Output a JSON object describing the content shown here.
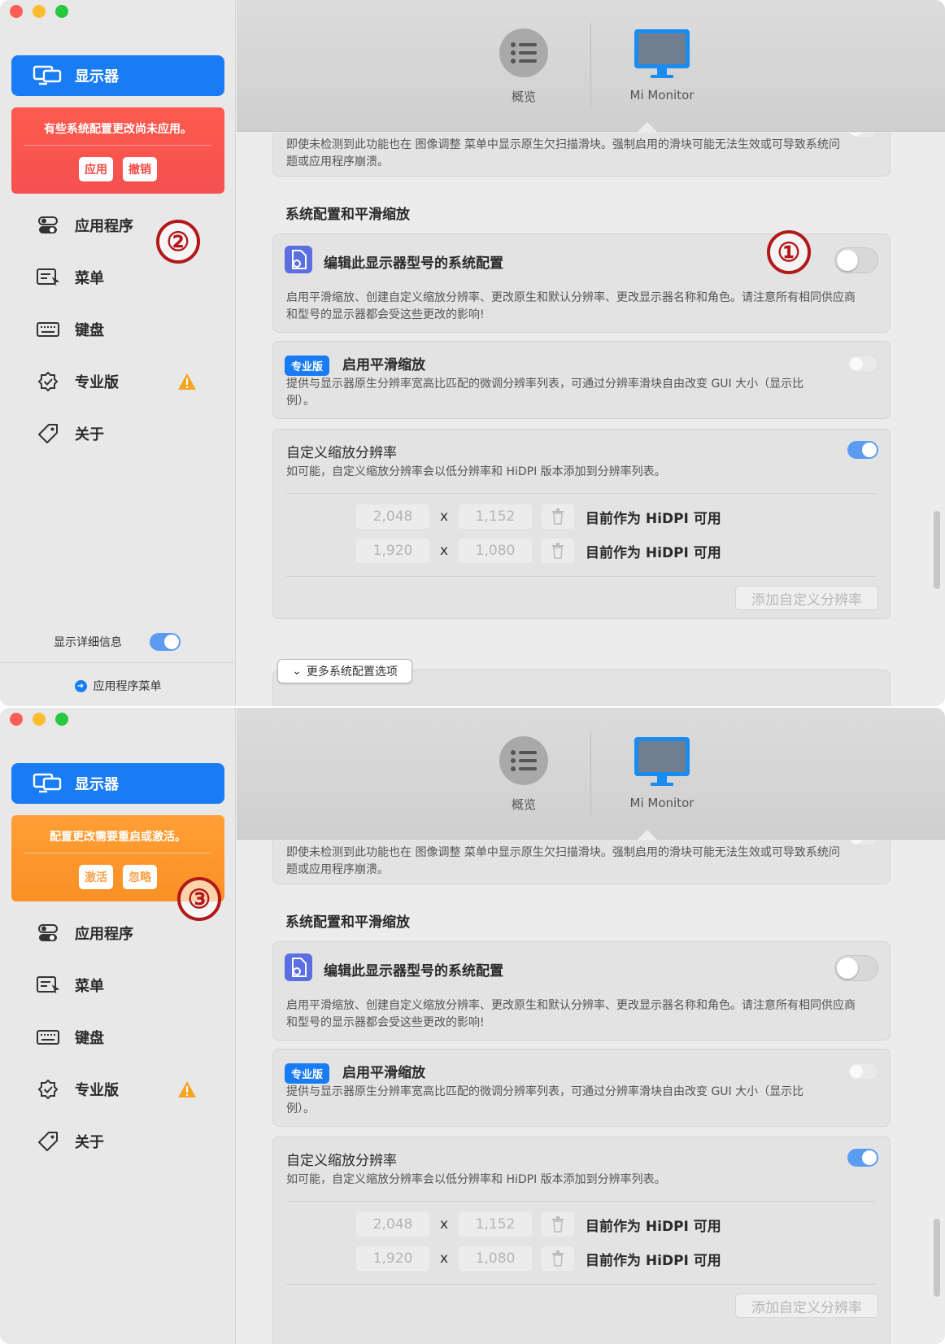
{
  "sidebar": {
    "selected": "显示器",
    "items": [
      {
        "label": "应用程序",
        "icon": "toggles-icon"
      },
      {
        "label": "菜单",
        "icon": "menu-icon"
      },
      {
        "label": "键盘",
        "icon": "keyboard-icon"
      },
      {
        "label": "专业版",
        "icon": "badge-check-icon",
        "warning": true
      },
      {
        "label": "关于",
        "icon": "tag-icon"
      }
    ],
    "show_details_label": "显示详细信息",
    "app_menu_label": "应用程序菜单"
  },
  "banners": [
    {
      "message": "有些系统配置更改尚未应用。",
      "primary": "应用",
      "secondary": "撤销",
      "color": "#f45050"
    },
    {
      "message": "配置更改需要重启或激活。",
      "primary": "激活",
      "secondary": "忽略",
      "color": "#fa9026"
    }
  ],
  "toolbar": {
    "overview_label": "概览",
    "monitor_label": "Mi Monitor"
  },
  "main": {
    "top_card_desc": "即使未检测到此功能也在 图像调整 菜单中显示原生欠扫描滑块。强制启用的滑块可能无法生效或可导致系统问题或应用程序崩溃。",
    "section_title": "系统配置和平滑缩放",
    "edit_config": {
      "title": "编辑此显示器型号的系统配置",
      "desc": "启用平滑缩放、创建自定义缩放分辨率、更改原生和默认分辨率、更改显示器名称和角色。请注意所有相同供应商和型号的显示器都会受这些更改的影响!",
      "enabled": false
    },
    "smooth_scaling": {
      "badge": "专业版",
      "title": "启用平滑缩放",
      "desc": "提供与显示器原生分辨率宽高比匹配的微调分辨率列表，可通过分辨率滑块自由改变 GUI 大小（显示比例）。",
      "enabled": false
    },
    "custom_res": {
      "title": "自定义缩放分辨率",
      "desc": "如可能，自定义缩放分辨率会以低分辨率和 HiDPI 版本添加到分辨率列表。",
      "enabled": true,
      "rows": [
        {
          "w": "2,048",
          "h": "1,152",
          "status": "目前作为 HiDPI 可用"
        },
        {
          "w": "1,920",
          "h": "1,080",
          "status": "目前作为 HiDPI 可用"
        }
      ],
      "x": "x",
      "add_label": "添加自定义分辨率"
    },
    "more_options_label": "更多系统配置选项"
  },
  "annotations": [
    "①",
    "②",
    "③"
  ]
}
